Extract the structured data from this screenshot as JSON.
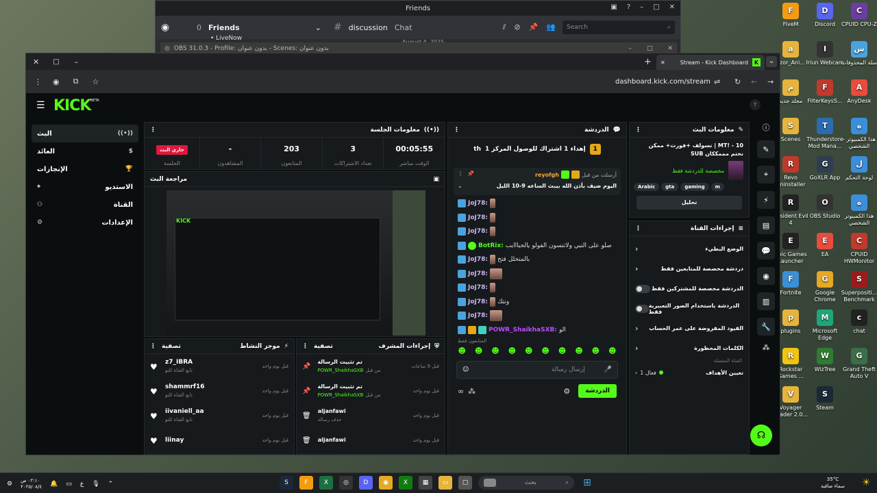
{
  "discord": {
    "window_title": "Friends",
    "friends_count": "0",
    "friends_label": "Friends",
    "channel": "discussion",
    "channel_tab": "Chat",
    "search_placeholder": "Search",
    "live_item": "LiveNow",
    "date_fragment": "August 4, 2025"
  },
  "obs": {
    "title": "OBS 31.0.3 - Profile: بدون عنوان - Scenes: بدون عنوان"
  },
  "browser": {
    "tab_title": "Stream - Kick Dashboard",
    "url": "dashboard.kick.com/stream"
  },
  "kick": {
    "logo": "KICK",
    "logo_beta": "BETA",
    "corner_badge": "7",
    "sidebar": [
      {
        "label": "البث",
        "icon": "broadcast-icon"
      },
      {
        "label": "العائد",
        "icon": "dollar-icon"
      },
      {
        "label": "الإنجازات",
        "icon": "trophy-icon"
      },
      {
        "label": "الاستديو",
        "icon": "studio-icon"
      },
      {
        "label": "القناة",
        "icon": "channel-icon"
      },
      {
        "label": "الإعدادات",
        "icon": "settings-icon"
      }
    ],
    "session": {
      "title": "معلومات الجلسة",
      "live_badge": "جاري البث",
      "stats": [
        {
          "value": "-",
          "label": "المشاهدون"
        },
        {
          "value": "203",
          "label": "المتابعون"
        },
        {
          "value": "3",
          "label": "تعداد الاشتراكات"
        },
        {
          "value": "00:05:55",
          "label": "الوقت مباشر"
        }
      ],
      "session_label": "الجلسة"
    },
    "preview": {
      "title": "مراجعة البث"
    },
    "activity": {
      "title": "موجز النشاط",
      "filter": "تصفية",
      "items": [
        {
          "user": "z7_IBRA",
          "sub": "تابع القناة للتو",
          "time": "قبل يوم واحد"
        },
        {
          "user": "shammrf16",
          "sub": "تابع القناة للتو",
          "time": "قبل يوم واحد"
        },
        {
          "user": "iivaniell_aa",
          "sub": "تابع القناة للتو",
          "time": "قبل يوم واحد"
        },
        {
          "user": "liinay",
          "sub": "",
          "time": "قبل يوم واحد"
        }
      ]
    },
    "mod": {
      "title": "إجراءات المشرف",
      "filter": "تصفية",
      "items": [
        {
          "action": "تم تثبيت الرسالة",
          "by": "POWR_ShaikhaSXB",
          "from": "من قبل",
          "time": "قبل 9 ساعات",
          "icon": "pin-icon"
        },
        {
          "action": "تم تثبيت الرسالة",
          "by": "POWR_ShaikhaSXB",
          "from": "من قبل",
          "time": "قبل يوم واحد",
          "icon": "pin-icon"
        },
        {
          "action": "aljanfawi",
          "by": "حذف رسالة",
          "from": "",
          "time": "قبل يوم واحد",
          "icon": "trash-icon"
        },
        {
          "action": "aljanfawi",
          "by": "",
          "from": "",
          "time": "قبل يوم واحد",
          "icon": "trash-icon"
        }
      ]
    },
    "chat": {
      "title": "الدردشة",
      "goal_text": "إهداء 1 اشتراك للوصول المركز 1",
      "goal_suffix": "th",
      "goal_rank": "1",
      "pinned_by": "أرسلت من قبل",
      "pinned_user": "reyofgh",
      "pinned_text": "اليوم ضيف بأذن الله بيبث الساعه 9-10 الليل",
      "messages": [
        {
          "user": "JoJ78:",
          "text": ""
        },
        {
          "user": "JoJ78:",
          "text": ""
        },
        {
          "user": "JoJ78:",
          "text": ""
        },
        {
          "user": "BotRix:",
          "text": "صلو على النبي ولاتنسون الفولو يالحبااايب"
        },
        {
          "user": "JoJ78:",
          "text": "بالمتخلل فتح"
        },
        {
          "user": "JoJ78:",
          "text": ""
        },
        {
          "user": "JoJ78:",
          "text": ""
        },
        {
          "user": "JoJ78:",
          "text": "ونتك"
        },
        {
          "user": "JoJ78:",
          "text": ""
        },
        {
          "user": "POWR_ShaikhaSXB:",
          "text": "الو"
        }
      ],
      "followers_only": "المتابعون فقط",
      "input_placeholder": "إرسال رسالة",
      "send_label": "الدردشة"
    },
    "stream_info": {
      "title": "معلومات البث",
      "stream_title": "نسولف +فورت+ ممكن | MT! - 10 SUB نختم مممككان",
      "chat_note": "مخصصة للدردشة فقط",
      "tags": [
        "Arabic",
        "gta",
        "gaming",
        "m"
      ],
      "edit_label": "تحليل"
    },
    "channel_actions": {
      "title": "إجراءات القناة",
      "items": [
        {
          "label": "الوضع البطيء",
          "control": "chevron"
        },
        {
          "label": "دردشة مخصصة للمتابعين فقط",
          "control": "chevron"
        },
        {
          "label": "الدردشة مخصصة للمشتركين فقط",
          "control": "toggle"
        },
        {
          "label": "الدردشة باستخدام الصور التعبيرية فقط",
          "control": "toggle"
        },
        {
          "label": "القيود المفروضة على عمر الحساب",
          "control": "chevron"
        },
        {
          "label": "الكلمات المحظورة",
          "control": "chevron"
        }
      ],
      "vip_label": "القناة المفضلة",
      "goals_label": "تعيين الأهداف",
      "goals_status": "فعال 1"
    }
  },
  "desktop_icons": [
    {
      "label": "FiveM",
      "color": "#f39c12"
    },
    {
      "label": "Discord",
      "color": "#5865f2"
    },
    {
      "label": "CPUID CPU-Z",
      "color": "#6a3ea1"
    },
    {
      "label": "azor_Ani...",
      "color": "#e6b43c"
    },
    {
      "label": "Iriun Webcam",
      "color": "#333"
    },
    {
      "label": "سلة المحذوفات",
      "color": "#4aa3df"
    },
    {
      "label": "مجلد جديد",
      "color": "#e6b43c"
    },
    {
      "label": "FilterKeysS...",
      "color": "#c0392b"
    },
    {
      "label": "AnyDesk",
      "color": "#e74c3c"
    },
    {
      "label": "Scenes",
      "color": "#e6b43c"
    },
    {
      "label": "Thunderstore Mod Mana...",
      "color": "#2b6cb0"
    },
    {
      "label": "هذا الكمبيوتر - الشخصي",
      "color": "#3a8fd8"
    },
    {
      "label": "Revo Uninstaller",
      "color": "#c0392b"
    },
    {
      "label": "GoXLR App",
      "color": "#2c3e50"
    },
    {
      "label": "لوحة التحكم",
      "color": "#3a8fd8"
    },
    {
      "label": "Resident Evil 4",
      "color": "#222"
    },
    {
      "label": "OBS Studio",
      "color": "#333"
    },
    {
      "label": "هذا الكمبيوتر الشخصي",
      "color": "#3a8fd8"
    },
    {
      "label": "Epic Games Launcher",
      "color": "#222"
    },
    {
      "label": "EA",
      "color": "#e74c3c"
    },
    {
      "label": "CPUID HWMonitor",
      "color": "#c0392b"
    },
    {
      "label": "Fortnite",
      "color": "#3a8fd8"
    },
    {
      "label": "Google Chrome",
      "color": "#e7a823"
    },
    {
      "label": "Superpositi... Benchmark",
      "color": "#9b1c1c"
    },
    {
      "label": "plugins",
      "color": "#e6b43c"
    },
    {
      "label": "Microsoft Edge",
      "color": "#1fa67a"
    },
    {
      "label": "chat",
      "color": "#222"
    },
    {
      "label": "Rockstar Games ...",
      "color": "#f1c40f"
    },
    {
      "label": "WizTree",
      "color": "#2e7d32"
    },
    {
      "label": "Grand Theft Auto V",
      "color": "#3c6e47"
    },
    {
      "label": "Voyager shader 2.0...",
      "color": "#e6b43c"
    },
    {
      "label": "Steam",
      "color": "#1b2838"
    }
  ],
  "taskbar": {
    "search_placeholder": "بحث",
    "time": "٠٢:١٠ ص",
    "date": "٢٠٢٥/٠٨/٤",
    "lang": "ع",
    "weather_temp": "35°C",
    "weather_text": "سماء صافية"
  }
}
